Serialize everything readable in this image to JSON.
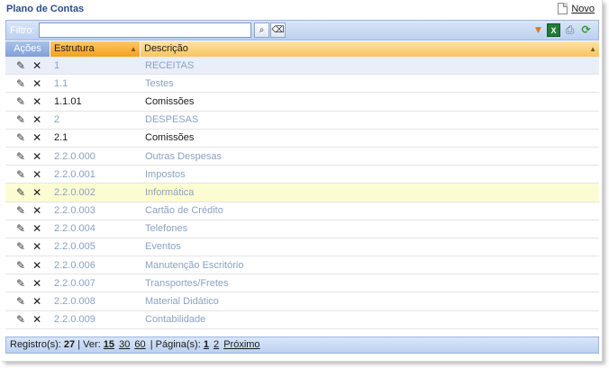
{
  "header": {
    "title": "Plano de Contas",
    "novo_label": "Novo"
  },
  "filter": {
    "label": "Filtro:",
    "value": ""
  },
  "toolbar": {
    "icons": [
      "search-icon",
      "clear-icon",
      "filter-icon",
      "excel-icon",
      "print-icon",
      "refresh-icon"
    ]
  },
  "grid": {
    "columns": [
      "Ações",
      "Estrutura",
      "Descrição"
    ],
    "rows": [
      {
        "estrutura": "1",
        "descricao": "RECEITAS",
        "muted": true
      },
      {
        "estrutura": "1.1",
        "descricao": "Testes",
        "muted": true
      },
      {
        "estrutura": "1.1.01",
        "descricao": "Comissões",
        "muted": false
      },
      {
        "estrutura": "2",
        "descricao": "DESPESAS",
        "muted": true
      },
      {
        "estrutura": "2.1",
        "descricao": "Comissões",
        "muted": false
      },
      {
        "estrutura": "2.2.0.000",
        "descricao": "Outras Despesas",
        "muted": true
      },
      {
        "estrutura": "2.2.0.001",
        "descricao": "Impostos",
        "muted": true
      },
      {
        "estrutura": "2.2.0.002",
        "descricao": "Informática",
        "muted": true
      },
      {
        "estrutura": "2.2.0.003",
        "descricao": "Cartão de Crédito",
        "muted": true
      },
      {
        "estrutura": "2.2.0.004",
        "descricao": "Telefones",
        "muted": true
      },
      {
        "estrutura": "2.2.0.005",
        "descricao": "Eventos",
        "muted": true
      },
      {
        "estrutura": "2.2.0.006",
        "descricao": "Manutenção Escritório",
        "muted": true
      },
      {
        "estrutura": "2.2.0.007",
        "descricao": "Transportes/Fretes",
        "muted": true
      },
      {
        "estrutura": "2.2.0.008",
        "descricao": "Material Didático",
        "muted": true
      },
      {
        "estrutura": "2.2.0.009",
        "descricao": "Contabilidade",
        "muted": true
      }
    ]
  },
  "footer": {
    "registros_label": "Registro(s):",
    "registros_count": "27",
    "ver_label": "| Ver:",
    "page_sizes": [
      "15",
      "30",
      "60"
    ],
    "paginas_label": "| Página(s):",
    "pages": [
      "1",
      "2"
    ],
    "proximo": "Próximo"
  },
  "colors": {
    "accent_blue": "#2b4d8c",
    "header_orange": "#f2a11d",
    "highlight_row": "#fcfcd2"
  }
}
